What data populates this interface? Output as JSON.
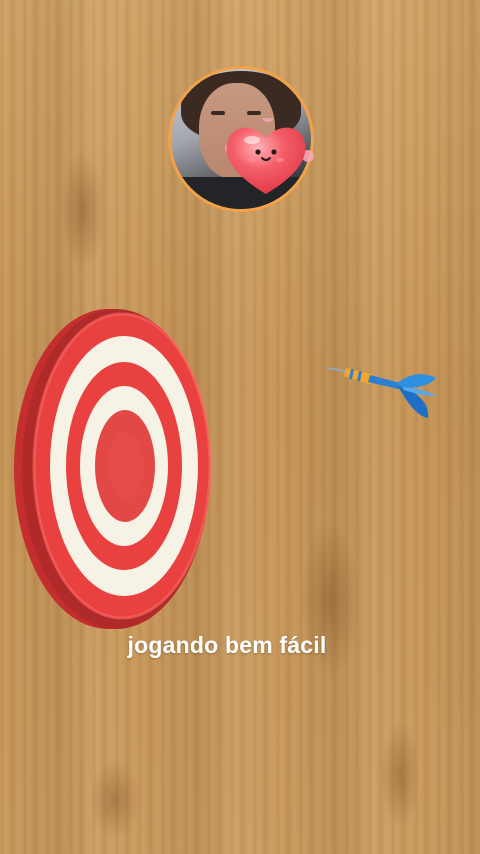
{
  "caption": {
    "text": "jogando bem fácil"
  },
  "avatar": {
    "icon": "user-avatar-photo",
    "border_color": "#f3a24a"
  },
  "sticker": {
    "icon": "heart-face-sticker",
    "color": "#f04a55"
  },
  "target": {
    "icon": "dartboard-icon",
    "ring_colors": [
      "#e8413f",
      "#f7f2e6"
    ]
  },
  "dart": {
    "icon": "dart-icon",
    "flight_color": "#2f8fe0",
    "shaft_color": "#f2a62a"
  },
  "background": {
    "texture": "wood",
    "color": "#c89a5e"
  }
}
